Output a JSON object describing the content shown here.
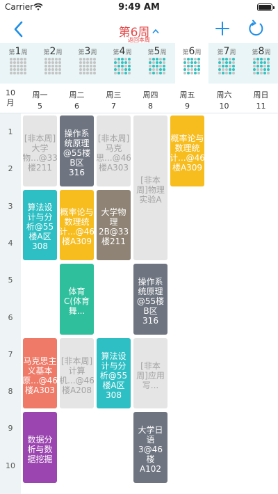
{
  "status_bar": {
    "carrier": "Carrier",
    "time": "9:49 AM"
  },
  "nav": {
    "title": "第6周",
    "subtitle": "返回本周",
    "icons": [
      "back-icon",
      "chevron-up-icon",
      "add-icon",
      "refresh-icon"
    ]
  },
  "weeks": [
    {
      "num": "1",
      "suffix": "周"
    },
    {
      "num": "2",
      "suffix": "周"
    },
    {
      "num": "3",
      "suffix": "周"
    },
    {
      "num": "4",
      "suffix": "周"
    },
    {
      "num": "5",
      "suffix": "周"
    },
    {
      "num": "6",
      "suffix": "周",
      "current": true
    },
    {
      "num": "7",
      "suffix": "周"
    },
    {
      "num": "8",
      "suffix": "周"
    }
  ],
  "days_header": {
    "month": "10",
    "month_unit": "月",
    "days": [
      {
        "name": "周一",
        "date": "5"
      },
      {
        "name": "周二",
        "date": "6"
      },
      {
        "name": "周三",
        "date": "7"
      },
      {
        "name": "周四",
        "date": "8"
      },
      {
        "name": "周五",
        "date": "9"
      },
      {
        "name": "周六",
        "date": "10"
      },
      {
        "name": "周日",
        "date": "11"
      }
    ]
  },
  "slots": [
    "1",
    "2",
    "3",
    "4",
    "5",
    "6",
    "7",
    "8",
    "9",
    "10"
  ],
  "courses": [
    {
      "day": 1,
      "start": 1,
      "end": 2,
      "text": "[非本周]大学物...@33楼211",
      "off_week": true
    },
    {
      "day": 2,
      "start": 1,
      "end": 2,
      "text": "操作系统原理@55楼B区316",
      "color": "#6e7580"
    },
    {
      "day": 3,
      "start": 1,
      "end": 2,
      "text": "[非本周]马克思...@46楼A303",
      "off_week": true
    },
    {
      "day": 4,
      "start": 1,
      "end": 4,
      "text": "[非本周]物理实验A",
      "off_week": true
    },
    {
      "day": 5,
      "start": 1,
      "end": 2,
      "text": "概率论与数理统计...@46楼A309",
      "color": "#f7bd1f"
    },
    {
      "day": 1,
      "start": 3,
      "end": 4,
      "text": "算法设计与分析@55楼A区308",
      "color": "#2ebfc4"
    },
    {
      "day": 2,
      "start": 3,
      "end": 4,
      "text": "概率论与数理统计...@46楼A309",
      "color": "#f7bd1f"
    },
    {
      "day": 3,
      "start": 3,
      "end": 4,
      "text": "大学物理2B@33楼211",
      "color": "#8e8374"
    },
    {
      "day": 2,
      "start": 5,
      "end": 6,
      "text": "体育C(体育舞...",
      "color": "#2fbf9c"
    },
    {
      "day": 4,
      "start": 5,
      "end": 6,
      "text": "操作系统原理@55楼B区316",
      "color": "#6e7580"
    },
    {
      "day": 1,
      "start": 7,
      "end": 8,
      "text": "马克思主义基本原...@46楼A303",
      "color": "#ef7a68"
    },
    {
      "day": 2,
      "start": 7,
      "end": 8,
      "text": "[非本周]计算机...@46楼A208",
      "off_week": true
    },
    {
      "day": 3,
      "start": 7,
      "end": 8,
      "text": "算法设计与分析@55楼A区308",
      "color": "#2ebfc4"
    },
    {
      "day": 4,
      "start": 7,
      "end": 8,
      "text": "[非本周]应用写...",
      "off_week": true
    },
    {
      "day": 1,
      "start": 9,
      "end": 10,
      "text": "数据分析与数据挖掘",
      "color": "#9b45b0"
    },
    {
      "day": 4,
      "start": 9,
      "end": 10,
      "text": "大学日语3@46楼A102",
      "color": "#6e7580"
    }
  ]
}
